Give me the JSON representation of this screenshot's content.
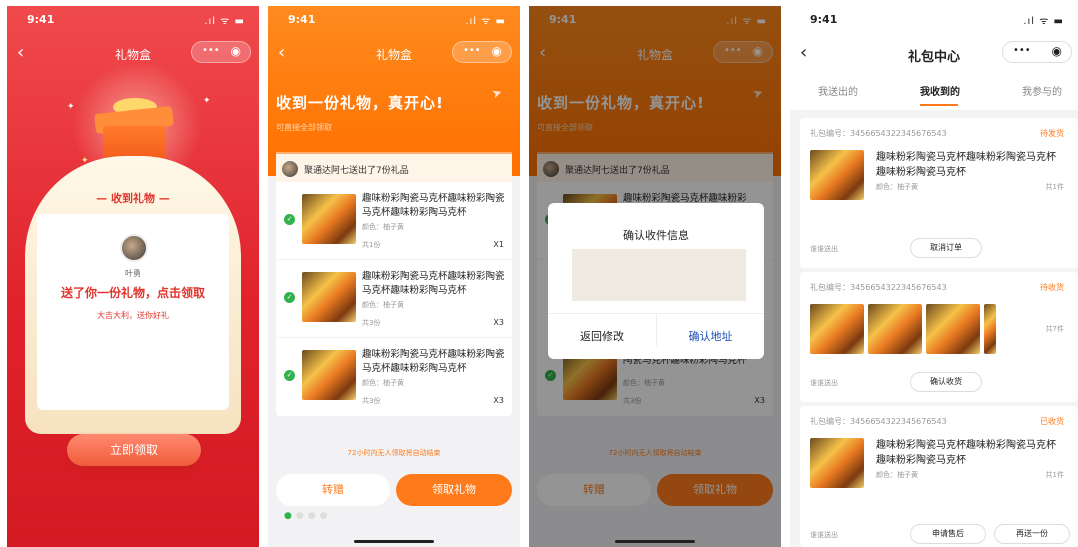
{
  "status_time": "9:41",
  "status_icons": ".ıl ᯤ ▬",
  "phone1": {
    "title": "礼物盒",
    "gift_label": "— 收到礼物 —",
    "sender_name": "叶勇",
    "message": "送了你一份礼物，点击领取",
    "wish": "大吉大利，送你好礼",
    "claim_button": "立即领取"
  },
  "phone2": {
    "title": "礼物盒",
    "headline": "收到一份礼物，真开心!",
    "subtitle": "可直接全部领取",
    "sender_line": "聚通达阿七送出了7份礼品",
    "items": [
      {
        "name": "趣味粉彩陶瓷马克杯趣味粉彩陶瓷马克杯趣味粉彩陶马克杯",
        "color": "颜色：柚子黄",
        "count": "共1份",
        "qty": "X1"
      },
      {
        "name": "趣味粉彩陶瓷马克杯趣味粉彩陶瓷马克杯趣味粉彩陶马克杯",
        "color": "颜色：柚子黄",
        "count": "共3份",
        "qty": "X3"
      },
      {
        "name": "趣味粉彩陶瓷马克杯趣味粉彩陶瓷马克杯趣味粉彩陶马克杯",
        "color": "颜色：柚子黄",
        "count": "共3份",
        "qty": "X3"
      }
    ],
    "timeout_note": "72小时内无人领取将自动结束",
    "transfer_button": "转赠",
    "claim_button": "领取礼物"
  },
  "phone3": {
    "title": "礼物盒",
    "headline": "收到一份礼物，真开心!",
    "subtitle": "可直接全部领取",
    "sender_line": "聚通达阿七送出了7份礼品",
    "item_name_fragment": "趣味粉彩陶瓷马克杯趣味粉彩",
    "item_name_fragment2": "陶瓷马克杯趣味粉彩陶马克杯",
    "item_color": "颜色：柚子黄",
    "item_count": "共3份",
    "item_qty": "X3",
    "timeout_note": "72小时内无人领取将自动结束",
    "transfer_button": "转赠",
    "claim_button": "领取礼物",
    "dialog": {
      "title": "确认收件信息",
      "back_button": "返回修改",
      "confirm_button": "确认地址"
    }
  },
  "phone4": {
    "title": "礼包中心",
    "tabs": [
      "我送出的",
      "我收到的",
      "我参与的"
    ],
    "active_tab": "我收到的",
    "orders": [
      {
        "no": "礼包编号：3456654322345676543",
        "status": "待发货",
        "name": "趣味粉彩陶瓷马克杯趣味粉彩陶瓷马克杯趣味粉彩陶瓷马克杯",
        "color": "颜色：柚子黄",
        "qty": "共1件",
        "sender": "谁谁送出",
        "buttons": [
          "取消订单"
        ]
      },
      {
        "no": "礼包编号：3456654322345676543",
        "status": "待收货",
        "qty": "共7件",
        "sender": "谁谁送出",
        "buttons": [
          "确认收货"
        ]
      },
      {
        "no": "礼包编号：3456654322345676543",
        "status": "已收货",
        "name": "趣味粉彩陶瓷马克杯趣味粉彩陶瓷马克杯趣味粉彩陶瓷马克杯",
        "color": "颜色：柚子黄",
        "qty": "共1件",
        "sender": "谁谁送出",
        "buttons": [
          "申请售后",
          "再送一份"
        ]
      }
    ]
  },
  "icons": [
    "back-chevron-icon",
    "more-dots-icon",
    "target-icon",
    "check-icon",
    "paper-plane-icon",
    "gift-box-icon"
  ],
  "colors": {
    "red": "#e0222c",
    "orange": "#ff7a1a",
    "green": "#32b24c",
    "link_blue": "#1a4db8"
  }
}
